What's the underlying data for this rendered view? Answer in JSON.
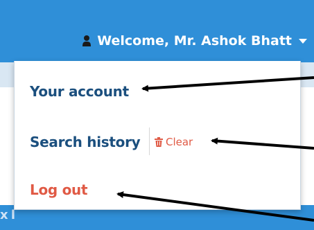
{
  "header": {
    "welcome_text": "Welcome, Mr. Ashok Bhatt",
    "user_icon": "user-icon",
    "caret_icon": "caret-down-icon"
  },
  "dropdown": {
    "items": [
      {
        "label": "Your account",
        "color": "#1b4f7e"
      },
      {
        "label": "Search history",
        "color": "#1b4f7e"
      },
      {
        "label": "Log out",
        "color": "#e05a45"
      }
    ],
    "clear": {
      "label": "Clear",
      "icon": "trash-icon",
      "color": "#e05a45"
    }
  },
  "background": {
    "partial_text": "x l"
  },
  "colors": {
    "header": "#2f8fd8",
    "accent_red": "#e05a45",
    "link_blue": "#1b4f7e"
  }
}
